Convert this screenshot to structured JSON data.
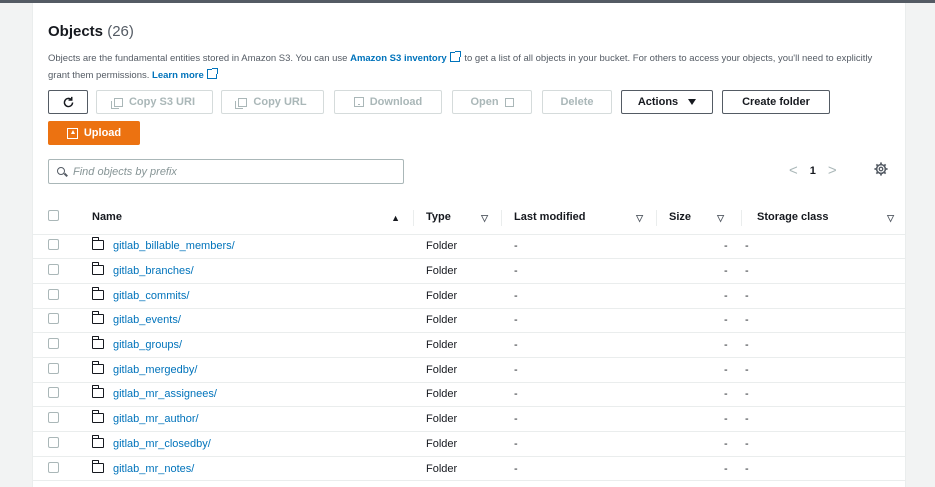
{
  "objects": {
    "title": "Objects",
    "count": "(26)",
    "description_1": "Objects are the fundamental entities stored in Amazon S3. You can use ",
    "inventory_link": "Amazon S3 inventory",
    "description_2": " to get a list of all objects in your bucket. For others to access your objects, you'll need to explicitly grant them permissions. ",
    "learn_more": "Learn more"
  },
  "toolbar": {
    "refresh_label": "C",
    "copy_s3_uri": "Copy S3 URI",
    "copy_url": "Copy URL",
    "download": "Download",
    "open": "Open",
    "delete": "Delete",
    "actions": "Actions",
    "create_folder": "Create folder",
    "upload": "Upload"
  },
  "search": {
    "placeholder": "Find objects by prefix"
  },
  "pagination": {
    "prev": "<",
    "current": "1",
    "next": ">"
  },
  "table": {
    "headers": {
      "name": "Name",
      "type": "Type",
      "last_modified": "Last modified",
      "size": "Size",
      "storage_class": "Storage class"
    },
    "rows": [
      {
        "name": "gitlab_billable_members/",
        "type": "Folder",
        "last_modified": "-",
        "size": "-",
        "storage_class": "-"
      },
      {
        "name": "gitlab_branches/",
        "type": "Folder",
        "last_modified": "-",
        "size": "-",
        "storage_class": "-"
      },
      {
        "name": "gitlab_commits/",
        "type": "Folder",
        "last_modified": "-",
        "size": "-",
        "storage_class": "-"
      },
      {
        "name": "gitlab_events/",
        "type": "Folder",
        "last_modified": "-",
        "size": "-",
        "storage_class": "-"
      },
      {
        "name": "gitlab_groups/",
        "type": "Folder",
        "last_modified": "-",
        "size": "-",
        "storage_class": "-"
      },
      {
        "name": "gitlab_mergedby/",
        "type": "Folder",
        "last_modified": "-",
        "size": "-",
        "storage_class": "-"
      },
      {
        "name": "gitlab_mr_assignees/",
        "type": "Folder",
        "last_modified": "-",
        "size": "-",
        "storage_class": "-"
      },
      {
        "name": "gitlab_mr_author/",
        "type": "Folder",
        "last_modified": "-",
        "size": "-",
        "storage_class": "-"
      },
      {
        "name": "gitlab_mr_closedby/",
        "type": "Folder",
        "last_modified": "-",
        "size": "-",
        "storage_class": "-"
      },
      {
        "name": "gitlab_mr_notes/",
        "type": "Folder",
        "last_modified": "-",
        "size": "-",
        "storage_class": "-"
      }
    ]
  },
  "colors": {
    "link": "#0073bb",
    "primary": "#ec7211",
    "text": "#16191f",
    "muted": "#545b64"
  }
}
